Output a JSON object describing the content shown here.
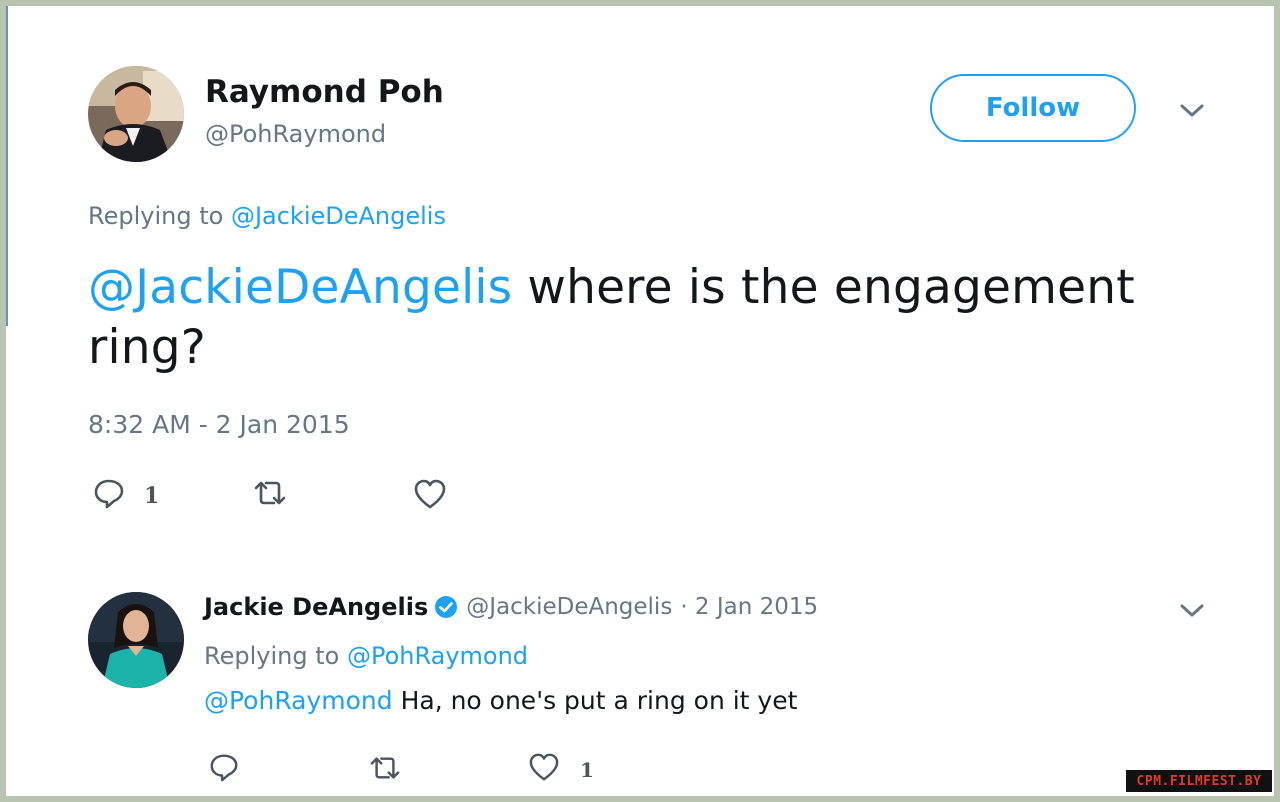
{
  "tweet": {
    "author_name": "Raymond Poh",
    "author_handle": "@PohRaymond",
    "follow_label": "Follow",
    "replying_prefix": "Replying to",
    "replying_to": "@JackieDeAngelis",
    "text_mention": "@JackieDeAngelis",
    "text_body": " where is the engagement ring?",
    "timestamp": "8:32 AM - 2 Jan 2015",
    "reply_count": "1",
    "retweet_count": "",
    "like_count": ""
  },
  "reply": {
    "author_name": "Jackie DeAngelis",
    "verified": true,
    "author_handle": "@JackieDeAngelis",
    "date": "· 2 Jan 2015",
    "replying_prefix": "Replying to",
    "replying_to": "@PohRaymond",
    "text_mention": "@PohRaymond",
    "text_body": " Ha, no one's put a ring on it yet",
    "reply_count": "",
    "retweet_count": "",
    "like_count": "1"
  },
  "watermark": "CPM.FILMFEST.BY",
  "colors": {
    "link": "#1da1f2",
    "muted": "#657786",
    "text": "#14171a",
    "border": "#b8c4b0"
  },
  "icons": [
    "reply-icon",
    "retweet-icon",
    "like-icon",
    "chevron-down-icon",
    "verified-badge-icon"
  ]
}
